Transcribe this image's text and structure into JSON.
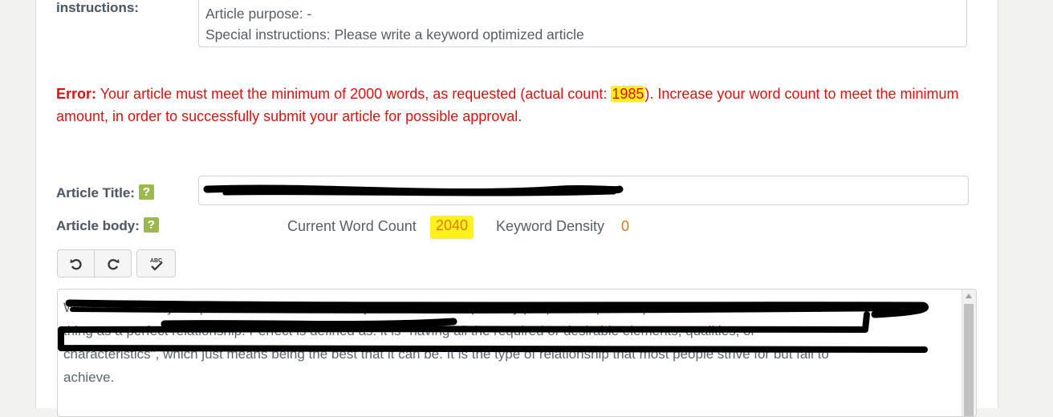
{
  "instructions": {
    "label": "instructions:",
    "article_purpose": "Article purpose: -",
    "special_instructions": "Special instructions: Please write a keyword optimized article"
  },
  "error": {
    "prefix": "Error:",
    "text_before": " Your article must meet the minimum of 2000 words, as requested (actual count: ",
    "actual_count": "1985",
    "text_after": "). Increase your word count to meet the minimum amount, in order to successfully submit your article for possible approval."
  },
  "article_title": {
    "label": "Article Title:",
    "help_icon": "?"
  },
  "article_body": {
    "label": "Article body:",
    "help_icon": "?"
  },
  "stats": {
    "word_count_label": "Current Word Count",
    "word_count": "2040",
    "keyword_density_label": "Keyword Density",
    "keyword_density": "0"
  },
  "toolbar": {
    "undo_icon": "undo-icon",
    "redo_icon": "redo-icon",
    "spellcheck_icon": "spellcheck-icon",
    "spellcheck_abc": "ABC"
  },
  "editor": {
    "line1": "We all know many couples that seem to have the perfect relationship. Many people are quick to point out that there is no such",
    "line2": "thing as a perfect relationship. Perfect is defined as: it is \"having all the required or desirable elements, qualities, or",
    "line3": "characteristics\", which just means being the best that it can be. It is the type of relationship that most people strive for but fail to",
    "line4": "achieve."
  },
  "colors": {
    "error": "#e01010",
    "highlight": "#fff21a",
    "accent_orange": "#e07a1a",
    "help_green": "#9cba4c"
  }
}
